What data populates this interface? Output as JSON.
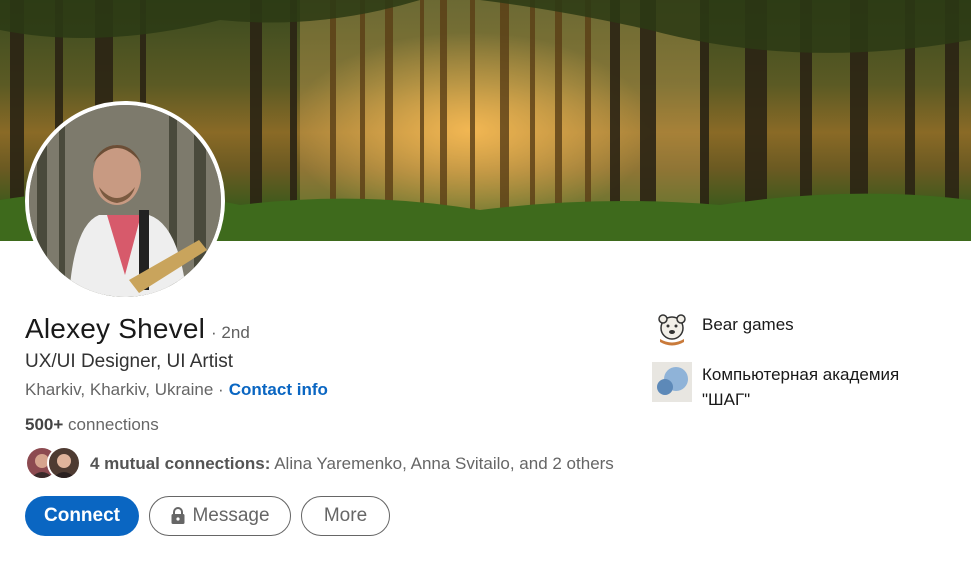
{
  "profile": {
    "name": "Alexey Shevel",
    "degree": "· 2nd",
    "headline": "UX/UI Designer, UI Artist",
    "location": "Kharkiv, Kharkiv, Ukraine ·",
    "contact_info": "Contact info",
    "connections_count": "500+",
    "connections_label": "connections"
  },
  "mutual": {
    "count_label": "4 mutual connections:",
    "names": "Alina Yaremenko, Anna Svitailo, and 2 others"
  },
  "actions": {
    "connect": "Connect",
    "message": "Message",
    "more": "More"
  },
  "experience": [
    {
      "name": "Bear games",
      "logo_icon": "bear-games-logo",
      "logo_text": "Bear games"
    },
    {
      "name": "Компьютерная академия \"ШАГ\"",
      "logo_icon": "circles-logo"
    }
  ],
  "colors": {
    "accent": "#0a66c2",
    "text_primary": "#191919",
    "text_secondary": "#666666"
  }
}
